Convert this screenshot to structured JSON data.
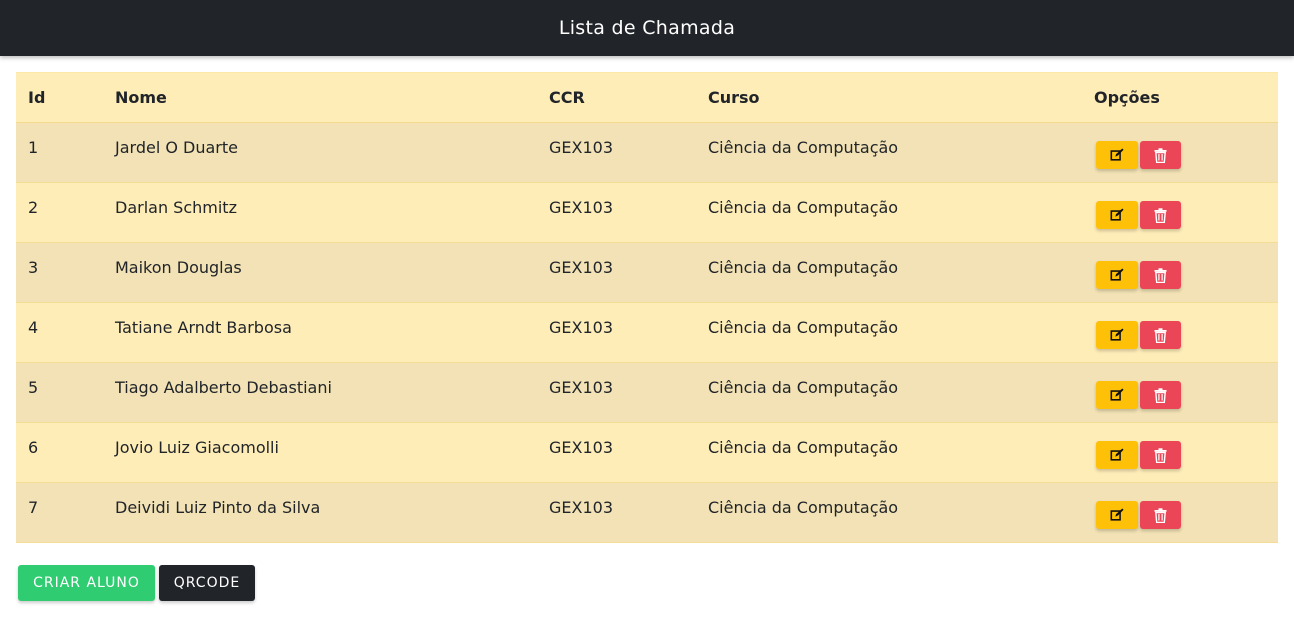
{
  "header": {
    "title": "Lista de Chamada"
  },
  "table": {
    "columns": [
      "Id",
      "Nome",
      "CCR",
      "Curso",
      "Opções"
    ],
    "rows": [
      {
        "id": "1",
        "nome": "Jardel O Duarte",
        "ccr": "GEX103",
        "curso": "Ciência da Computação"
      },
      {
        "id": "2",
        "nome": "Darlan Schmitz",
        "ccr": "GEX103",
        "curso": "Ciência da Computação"
      },
      {
        "id": "3",
        "nome": "Maikon Douglas",
        "ccr": "GEX103",
        "curso": "Ciência da Computação"
      },
      {
        "id": "4",
        "nome": "Tatiane Arndt Barbosa",
        "ccr": "GEX103",
        "curso": "Ciência da Computação"
      },
      {
        "id": "5",
        "nome": "Tiago Adalberto Debastiani",
        "ccr": "GEX103",
        "curso": "Ciência da Computação"
      },
      {
        "id": "6",
        "nome": "Jovio Luiz Giacomolli",
        "ccr": "GEX103",
        "curso": "Ciência da Computação"
      },
      {
        "id": "7",
        "nome": "Deividi Luiz Pinto da Silva",
        "ccr": "GEX103",
        "curso": "Ciência da Computação"
      }
    ],
    "row_actions": {
      "edit_icon": "edit-icon",
      "delete_icon": "trash-icon"
    }
  },
  "actions": {
    "create_label": "CRIAR ALUNO",
    "qrcode_label": "QRCODE"
  },
  "colors": {
    "header_bg": "#212529",
    "table_header_bg": "#ffedb8",
    "row_alt_bg": "#f2e2b5",
    "edit_button": "#ffc107",
    "delete_button": "#eb4658",
    "create_button": "#2fcc71",
    "qrcode_button": "#212529"
  }
}
